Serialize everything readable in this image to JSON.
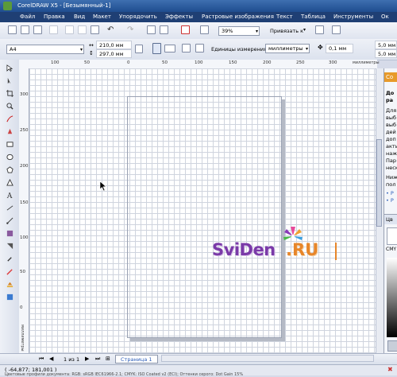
{
  "window": {
    "title": "CorelDRAW X5 - [Безымянный-1]"
  },
  "menu": [
    "Файл",
    "Правка",
    "Вид",
    "Макет",
    "Упорядочить",
    "Эффекты",
    "Растровые изображения",
    "Текст",
    "Таблица",
    "Инструменты",
    "Ок"
  ],
  "toolbar": {
    "zoom": "39%",
    "snap": "Привязать к"
  },
  "properties": {
    "page_size": "A4",
    "width": "210,0 мм",
    "height": "297,0 мм",
    "units_label": "Единицы измерения:",
    "units": "миллиметры",
    "nudge": "0,1 мм",
    "dup1": "5,0 мм",
    "dup2": "5,0 мм"
  },
  "ruler": {
    "h": [
      "100",
      "50",
      "0",
      "50",
      "100",
      "150",
      "200",
      "250",
      "300"
    ],
    "unit": "миллиметры",
    "v": [
      "300",
      "250",
      "200",
      "150",
      "100",
      "50",
      "0"
    ],
    "v_unit": "миллиметры"
  },
  "docker": {
    "header": "Со",
    "lines": [
      "До",
      "ра",
      "Для",
      "выб",
      "выб",
      "дей",
      "доп",
      "акти",
      "наж",
      "Пар",
      "неск",
      "Ниж",
      "пол",
      "• Р",
      "• Р"
    ],
    "section2": "Цв",
    "cmyk": "CMY"
  },
  "pagebar": {
    "page_count": "1 из 1",
    "page_tab": "Страница 1"
  },
  "status": {
    "coords": "( -64,877; 181,001 )",
    "profiles": "Цветовые профили документа: RGB: sRGB IEC61966-2.1; CMYK: ISO Coated v2 (ECI); Оттенки серого: Dot Gain 15%"
  },
  "watermark": {
    "text_left": "SviDen",
    "text_right": ".RU"
  },
  "colors": {
    "title_bar": "#1f4d8f",
    "menu_bar": "#1f3f74",
    "docker_accent": "#e79a2a"
  }
}
